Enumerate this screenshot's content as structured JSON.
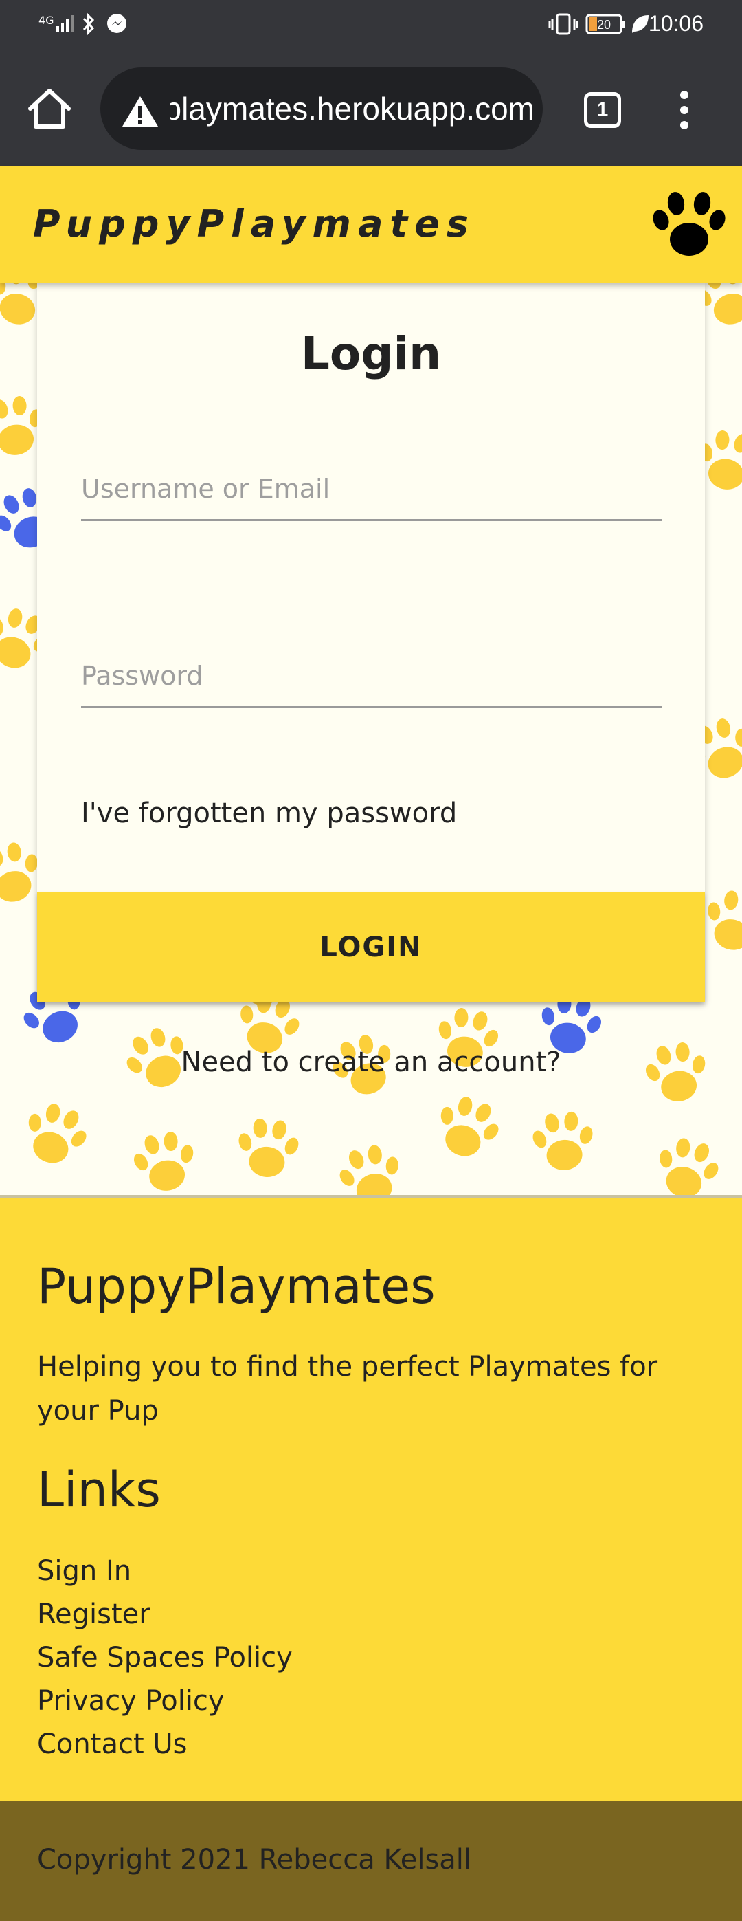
{
  "status_bar": {
    "network": "4G",
    "battery": "20",
    "time": "10:06"
  },
  "browser": {
    "url": "puppyplaymates.herokuapp.com",
    "tab_count": "1"
  },
  "header": {
    "brand": "PuppyPlaymates"
  },
  "login": {
    "title": "Login",
    "username_placeholder": "Username or Email",
    "password_placeholder": "Password",
    "forgot_label": "I've forgotten my password",
    "button_label": "LOGIN",
    "create_account_label": "Need to create an account?"
  },
  "footer": {
    "brand": "PuppyPlaymates",
    "tagline": "Helping you to find the perfect Playmates for your Pup",
    "links_heading": "Links",
    "links": [
      "Sign In",
      "Register",
      "Safe Spaces Policy",
      "Privacy Policy",
      "Contact Us"
    ],
    "copyright": "Copyright 2021 Rebecca Kelsall"
  },
  "colors": {
    "accent_yellow": "#fdda37",
    "paw_yellow": "#fccf3a",
    "paw_blue": "#4a67e8",
    "copyright_bar": "#7a6520",
    "browser_chrome": "#35363a"
  },
  "icons": {
    "home": "home-icon",
    "warning": "warning-icon",
    "menu": "more-vert-icon",
    "paw": "paw-icon"
  }
}
